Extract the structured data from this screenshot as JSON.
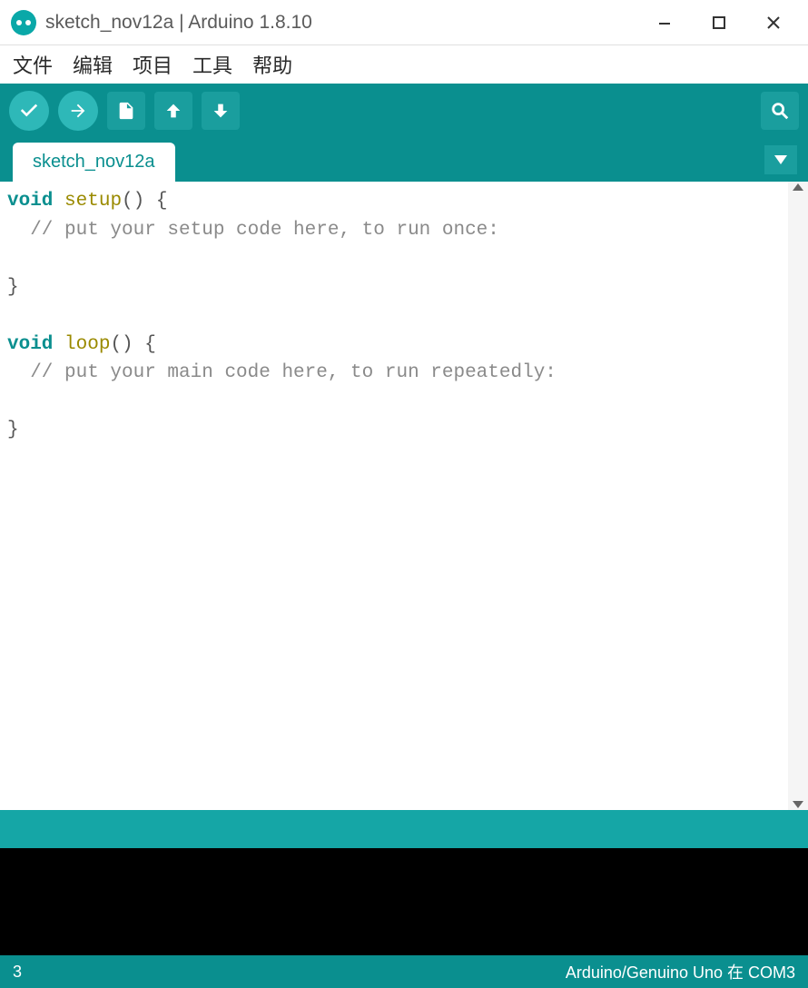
{
  "window": {
    "title": "sketch_nov12a | Arduino 1.8.10"
  },
  "menu": {
    "items": [
      "文件",
      "编辑",
      "项目",
      "工具",
      "帮助"
    ]
  },
  "toolbar": {
    "verify": "Verify",
    "upload": "Upload",
    "new": "New",
    "open": "Open",
    "save": "Save",
    "serial_monitor": "Serial Monitor"
  },
  "tabs": {
    "items": [
      "sketch_nov12a"
    ]
  },
  "editor": {
    "code_tokens": [
      {
        "t": "kw",
        "v": "void"
      },
      {
        "t": "txt",
        "v": " "
      },
      {
        "t": "fn",
        "v": "setup"
      },
      {
        "t": "txt",
        "v": "() {\n"
      },
      {
        "t": "comment",
        "v": "  // put your setup code here, to run once:"
      },
      {
        "t": "txt",
        "v": "\n\n}\n\n"
      },
      {
        "t": "kw",
        "v": "void"
      },
      {
        "t": "txt",
        "v": " "
      },
      {
        "t": "fn",
        "v": "loop"
      },
      {
        "t": "txt",
        "v": "() {\n"
      },
      {
        "t": "comment",
        "v": "  // put your main code here, to run repeatedly:"
      },
      {
        "t": "txt",
        "v": "\n\n}\n"
      }
    ]
  },
  "footer": {
    "line_number": "3",
    "board_port": "Arduino/Genuino Uno 在 COM3"
  }
}
